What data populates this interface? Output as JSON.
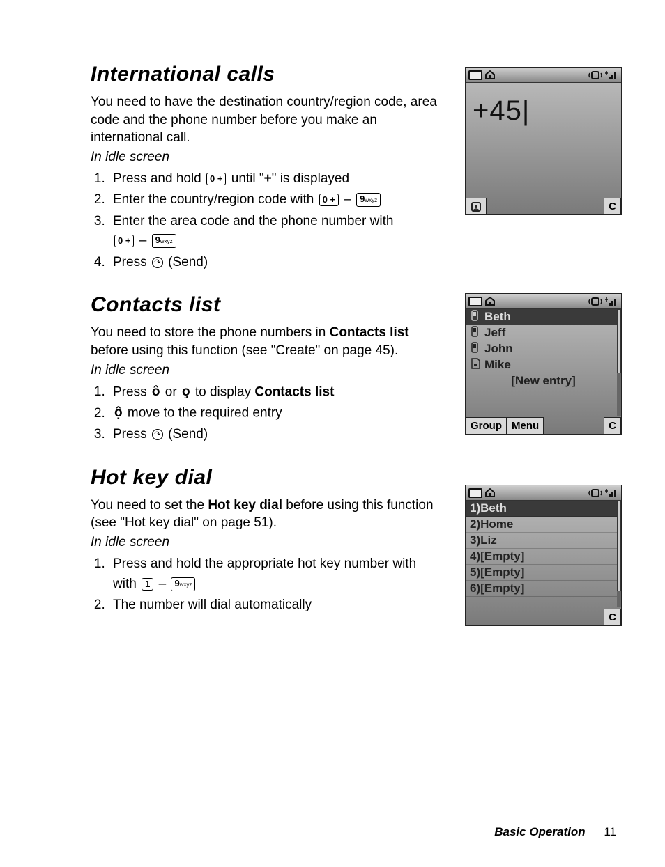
{
  "sections": {
    "intl": {
      "title": "International calls",
      "intro": "You need to have the destination country/region code, area code and the phone number before you make an international call.",
      "idle": "In idle screen",
      "steps": {
        "s1a": "Press and hold ",
        "s1b": " until \"",
        "s1c": "+",
        "s1d": "\" is displayed",
        "s2a": "Enter the country/region code with ",
        "s3a": "Enter the area code and the phone number with ",
        "s4a": "Press ",
        "s4b": " (Send)"
      }
    },
    "contacts": {
      "title": "Contacts list",
      "intro_a": "You need to store the phone numbers in ",
      "intro_bold": "Contacts list",
      "intro_b": " before using this function (see \"Create\" on page 45).",
      "idle": "In idle screen",
      "steps": {
        "s1a": "Press ",
        "s1b": " or ",
        "s1c": " to display ",
        "s1d": "Contacts list",
        "s2a": " move to the required entry",
        "s3a": "Press ",
        "s3b": " (Send)"
      }
    },
    "hotkey": {
      "title": "Hot key dial",
      "intro_a": "You need to set the ",
      "intro_bold": "Hot key dial",
      "intro_b": " before using this function (see \"Hot key dial\" on page 51).",
      "idle": "In idle screen",
      "steps": {
        "s1a": "Press and hold the appropriate hot key number with ",
        "s2a": "The number will dial automatically"
      }
    }
  },
  "keys": {
    "zero_plus": "0 +",
    "nine_wxyz": "9",
    "nine_sub": "wxyz",
    "one": "1",
    "dash": " – "
  },
  "screens": {
    "s1": {
      "text": "+45|"
    },
    "s2": {
      "rows": [
        "Beth",
        "Jeff",
        "John",
        "Mike"
      ],
      "new_entry": "[New entry]",
      "sk_left1": "Group",
      "sk_left2": "Menu",
      "sk_right": "C"
    },
    "s3": {
      "rows": [
        "1)Beth",
        "2)Home",
        "3)Liz",
        "4)[Empty]",
        "5)[Empty]",
        "6)[Empty]"
      ],
      "sk_right": "C"
    }
  },
  "footer": {
    "label": "Basic Operation",
    "page": "11"
  }
}
